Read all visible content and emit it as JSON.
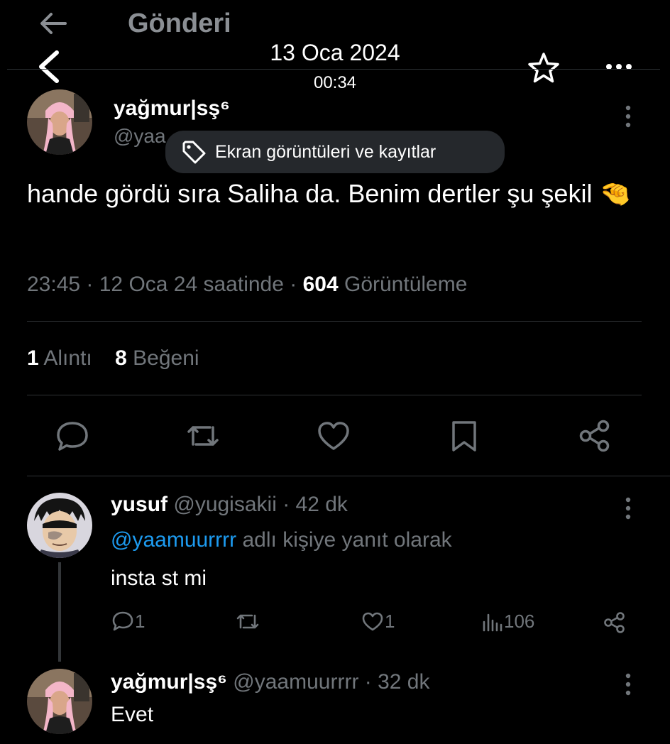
{
  "header": {
    "title": "Gönderi",
    "date": "13 Oca 2024",
    "time": "00:34"
  },
  "tweet": {
    "author_name": "yağmur|sş⁶",
    "author_handle_visible": "@yaa",
    "tooltip": "Ekran görüntüleri ve kayıtlar",
    "text": "hande gördü sıra Saliha da. Benim dertler şu şekil",
    "emoji": "🤏",
    "timestamp": "23:45 · 12 Oca 24 saatinde · ",
    "views_count": "604",
    "views_label": " Görüntüleme",
    "quotes_count": "1",
    "quotes_label": "Alıntı",
    "likes_count": "8",
    "likes_label": "Beğeni"
  },
  "actions": [
    "reply-icon",
    "retweet-icon",
    "like-icon",
    "bookmark-icon",
    "share-icon"
  ],
  "replies": [
    {
      "name": "yusuf",
      "handle_time": "@yugisakii · 42 dk",
      "mention": "@yaamuurrrr",
      "reply_to_label": "adlı kişiye yanıt olarak",
      "text": "insta st mi",
      "reply_count": "1",
      "like_count": "1",
      "view_count": "106"
    },
    {
      "name": "yağmur|sş⁶",
      "handle_time": "@yaamuurrrr · 32 dk",
      "text": "Evet"
    }
  ],
  "colors": {
    "background": "#000000",
    "text": "#e7e9ea",
    "muted": "#71767b",
    "link": "#1d9bf0",
    "divider": "#2f3336",
    "tooltip_bg": "#25282c"
  }
}
